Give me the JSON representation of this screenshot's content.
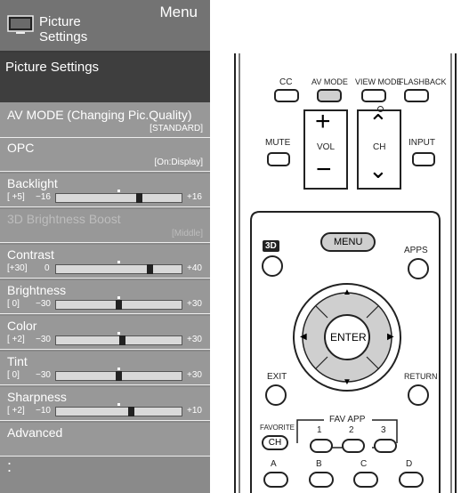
{
  "menu": {
    "header": {
      "title_line1": "Picture",
      "title_line2": "Settings",
      "menu_label": "Menu"
    },
    "section_title": "Picture Settings",
    "items": [
      {
        "label": "AV MODE (Changing Pic.Quality)",
        "value": "[STANDARD]"
      },
      {
        "label": "OPC",
        "value": "[On:Display]"
      },
      {
        "label": "Backlight",
        "current": "[ +5]",
        "min": "−16",
        "max": "+16",
        "level": 0.66
      },
      {
        "label": "3D Brightness Boost",
        "value": "[Middle]"
      },
      {
        "label": "Contrast",
        "current": "[+30]",
        "min": "0",
        "max": "+40",
        "level": 0.75
      },
      {
        "label": "Brightness",
        "current": "[  0]",
        "min": "−30",
        "max": "+30",
        "level": 0.5
      },
      {
        "label": "Color",
        "current": "[ +2]",
        "min": "−30",
        "max": "+30",
        "level": 0.53
      },
      {
        "label": "Tint",
        "current": "[  0]",
        "min": "−30",
        "max": "+30",
        "level": 0.5
      },
      {
        "label": "Sharpness",
        "current": "[ +2]",
        "min": "−10",
        "max": "+10",
        "level": 0.6
      },
      {
        "label": "Advanced"
      }
    ],
    "more_indicator": ":"
  },
  "remote": {
    "top_buttons": [
      "CC",
      "AV MODE",
      "VIEW MODE",
      "FLASHBACK"
    ],
    "mute": "MUTE",
    "vol": "VOL",
    "ch": "CH",
    "input": "INPUT",
    "three_d": "3D",
    "menu": "MENU",
    "apps": "APPS",
    "enter": "ENTER",
    "exit": "EXIT",
    "return": "RETURN",
    "favorite": "FAVORITE",
    "fav_ch": "CH",
    "fav_app": "FAV APP",
    "fav_numbers": [
      "1",
      "2",
      "3"
    ],
    "color_buttons": [
      "A",
      "B",
      "C",
      "D"
    ]
  }
}
